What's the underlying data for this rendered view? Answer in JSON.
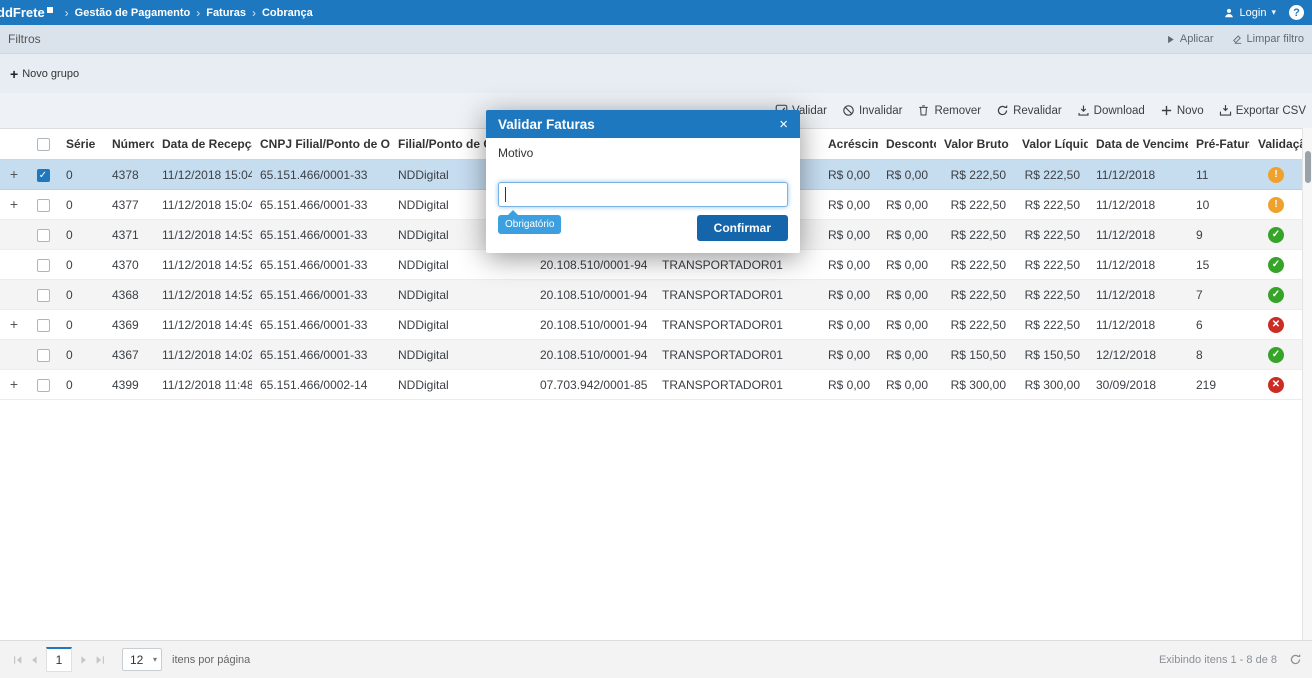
{
  "topbar": {
    "brand": "ddFrete",
    "breadcrumb": [
      "Gestão de Pagamento",
      "Faturas",
      "Cobrança"
    ],
    "login": "Login"
  },
  "filters": {
    "title": "Filtros",
    "apply": "Aplicar",
    "clear": "Limpar filtro",
    "new_group": "Novo grupo"
  },
  "toolbar": {
    "actions": [
      {
        "id": "validar",
        "label": "Validar",
        "icon": "check-square-icon"
      },
      {
        "id": "invalidar",
        "label": "Invalidar",
        "icon": "ban-icon"
      },
      {
        "id": "remover",
        "label": "Remover",
        "icon": "trash-icon"
      },
      {
        "id": "revalidar",
        "label": "Revalidar",
        "icon": "refresh-icon"
      },
      {
        "id": "download",
        "label": "Download",
        "icon": "download-icon"
      },
      {
        "id": "novo",
        "label": "Novo",
        "icon": "plus-icon"
      },
      {
        "id": "exportar-csv",
        "label": "Exportar CSV",
        "icon": "export-icon"
      }
    ]
  },
  "table": {
    "columns": [
      {
        "key": "serie",
        "label": "Série"
      },
      {
        "key": "numero",
        "label": "Número"
      },
      {
        "key": "data_recepcao",
        "label": "Data de Recepção",
        "sort": "desc"
      },
      {
        "key": "cnpj_filial",
        "label": "CNPJ Filial/Ponto de Operação"
      },
      {
        "key": "filial",
        "label": "Filial/Ponto de Operação"
      },
      {
        "key": "cnpj_transportador",
        "label": ""
      },
      {
        "key": "transportador",
        "label": ""
      },
      {
        "key": "acrescimo",
        "label": "Acréscimo"
      },
      {
        "key": "desconto",
        "label": "Desconto"
      },
      {
        "key": "valor_bruto",
        "label": "Valor Bruto"
      },
      {
        "key": "valor_liquido",
        "label": "Valor Líquido"
      },
      {
        "key": "data_vencimento",
        "label": "Data de Vencimento"
      },
      {
        "key": "pre_fatura",
        "label": "Pré-Fatura"
      },
      {
        "key": "validacao",
        "label": "Validação"
      }
    ],
    "rows": [
      {
        "expand": true,
        "checked": true,
        "selected": true,
        "serie": "0",
        "numero": "4378",
        "data_recepcao": "11/12/2018 15:04",
        "cnpj_filial": "65.151.466/0001-33",
        "filial": "NDDigital",
        "cnpj_transportador": "",
        "transportador": "",
        "acrescimo": "R$ 0,00",
        "desconto": "R$ 0,00",
        "valor_bruto": "R$ 222,50",
        "valor_liquido": "R$ 222,50",
        "data_vencimento": "11/12/2018",
        "pre_fatura": "11",
        "validacao": "warning-icon"
      },
      {
        "expand": true,
        "checked": false,
        "serie": "0",
        "numero": "4377",
        "data_recepcao": "11/12/2018 15:04",
        "cnpj_filial": "65.151.466/0001-33",
        "filial": "NDDigital",
        "cnpj_transportador": "",
        "transportador": "",
        "acrescimo": "R$ 0,00",
        "desconto": "R$ 0,00",
        "valor_bruto": "R$ 222,50",
        "valor_liquido": "R$ 222,50",
        "data_vencimento": "11/12/2018",
        "pre_fatura": "10",
        "validacao": "warning-icon"
      },
      {
        "expand": false,
        "checked": false,
        "serie": "0",
        "numero": "4371",
        "data_recepcao": "11/12/2018 14:53",
        "cnpj_filial": "65.151.466/0001-33",
        "filial": "NDDigital",
        "cnpj_transportador": "",
        "transportador": "",
        "acrescimo": "R$ 0,00",
        "desconto": "R$ 0,00",
        "valor_bruto": "R$ 222,50",
        "valor_liquido": "R$ 222,50",
        "data_vencimento": "11/12/2018",
        "pre_fatura": "9",
        "validacao": "success-icon"
      },
      {
        "expand": false,
        "checked": false,
        "serie": "0",
        "numero": "4370",
        "data_recepcao": "11/12/2018 14:52",
        "cnpj_filial": "65.151.466/0001-33",
        "filial": "NDDigital",
        "cnpj_transportador": "20.108.510/0001-94",
        "transportador": "TRANSPORTADOR01",
        "acrescimo": "R$ 0,00",
        "desconto": "R$ 0,00",
        "valor_bruto": "R$ 222,50",
        "valor_liquido": "R$ 222,50",
        "data_vencimento": "11/12/2018",
        "pre_fatura": "15",
        "validacao": "success-icon"
      },
      {
        "expand": false,
        "checked": false,
        "serie": "0",
        "numero": "4368",
        "data_recepcao": "11/12/2018 14:52",
        "cnpj_filial": "65.151.466/0001-33",
        "filial": "NDDigital",
        "cnpj_transportador": "20.108.510/0001-94",
        "transportador": "TRANSPORTADOR01",
        "acrescimo": "R$ 0,00",
        "desconto": "R$ 0,00",
        "valor_bruto": "R$ 222,50",
        "valor_liquido": "R$ 222,50",
        "data_vencimento": "11/12/2018",
        "pre_fatura": "7",
        "validacao": "success-icon"
      },
      {
        "expand": true,
        "checked": false,
        "serie": "0",
        "numero": "4369",
        "data_recepcao": "11/12/2018 14:49",
        "cnpj_filial": "65.151.466/0001-33",
        "filial": "NDDigital",
        "cnpj_transportador": "20.108.510/0001-94",
        "transportador": "TRANSPORTADOR01",
        "acrescimo": "R$ 0,00",
        "desconto": "R$ 0,00",
        "valor_bruto": "R$ 222,50",
        "valor_liquido": "R$ 222,50",
        "data_vencimento": "11/12/2018",
        "pre_fatura": "6",
        "validacao": "error-icon"
      },
      {
        "expand": false,
        "checked": false,
        "serie": "0",
        "numero": "4367",
        "data_recepcao": "11/12/2018 14:02",
        "cnpj_filial": "65.151.466/0001-33",
        "filial": "NDDigital",
        "cnpj_transportador": "20.108.510/0001-94",
        "transportador": "TRANSPORTADOR01",
        "acrescimo": "R$ 0,00",
        "desconto": "R$ 0,00",
        "valor_bruto": "R$ 150,50",
        "valor_liquido": "R$ 150,50",
        "data_vencimento": "12/12/2018",
        "pre_fatura": "8",
        "validacao": "success-icon"
      },
      {
        "expand": true,
        "checked": false,
        "serie": "0",
        "numero": "4399",
        "data_recepcao": "11/12/2018 11:48",
        "cnpj_filial": "65.151.466/0002-14",
        "filial": "NDDigital",
        "cnpj_transportador": "07.703.942/0001-85",
        "transportador": "TRANSPORTADOR01",
        "acrescimo": "R$ 0,00",
        "desconto": "R$ 0,00",
        "valor_bruto": "R$ 300,00",
        "valor_liquido": "R$ 300,00",
        "data_vencimento": "30/09/2018",
        "pre_fatura": "219",
        "validacao": "error-icon"
      }
    ]
  },
  "modal": {
    "title": "Validar Faturas",
    "close": "×",
    "field_label": "Motivo",
    "field_value": "",
    "required_hint": "Obrigatório",
    "confirm": "Confirmar"
  },
  "pagination": {
    "current_page": "1",
    "page_size": "12",
    "per_page_label": "itens por página",
    "summary": "Exibindo itens 1 - 8 de 8"
  },
  "colors": {
    "topbar": "#1e78bf",
    "accent": "#1e78bf",
    "confirm_button": "#1565ab",
    "hint_badge": "#3b9fe0",
    "selected_row": "#c6ddf0",
    "warning": "#efa12c",
    "success": "#35a428",
    "error": "#cb2d24"
  }
}
